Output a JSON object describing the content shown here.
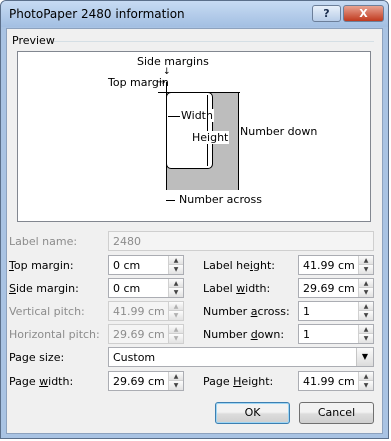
{
  "window": {
    "title": "PhotoPaper 2480 information",
    "help_label": "?",
    "close_label": "X"
  },
  "preview": {
    "group_label": "Preview",
    "side_margins": "Side margins",
    "top_margin": "Top margin",
    "width": "Width",
    "height": "Height",
    "number_down": "Number down",
    "number_across": "Number across"
  },
  "fields": {
    "label_name": {
      "label": "Label name:",
      "value": "2480"
    },
    "top_margin": {
      "label_hot": "T",
      "label_rest": "op margin:",
      "value": "0 cm"
    },
    "side_margin": {
      "label_hot": "S",
      "label_rest": "ide margin:",
      "value": "0 cm"
    },
    "vertical_pitch": {
      "label": "Vertical pitch:",
      "value": "41.99 cm"
    },
    "horizontal_pitch": {
      "label": "Horizontal pitch:",
      "value": "29.69 cm"
    },
    "label_height": {
      "label_pre": "Label he",
      "label_hot": "i",
      "label_rest": "ght:",
      "value": "41.99 cm"
    },
    "label_width": {
      "label_pre": "Label ",
      "label_hot": "w",
      "label_rest": "idth:",
      "value": "29.69 cm"
    },
    "number_across": {
      "label_pre": "Number ",
      "label_hot": "a",
      "label_rest": "cross:",
      "value": "1"
    },
    "number_down": {
      "label_pre": "Number ",
      "label_hot": "d",
      "label_rest": "own:",
      "value": "1"
    },
    "page_size": {
      "label": "Page size:",
      "value": "Custom"
    },
    "page_width": {
      "label_pre": "Page ",
      "label_hot": "w",
      "label_rest": "idth:",
      "value": "29.69 cm"
    },
    "page_height": {
      "label_pre": "Page ",
      "label_hot": "H",
      "label_rest": "eight:",
      "value": "41.99 cm"
    }
  },
  "buttons": {
    "ok": "OK",
    "cancel": "Cancel"
  },
  "icons": {
    "spin_up": "spin-up-arrow-icon",
    "spin_down": "spin-down-arrow-icon",
    "dropdown": "chevron-down-icon"
  }
}
